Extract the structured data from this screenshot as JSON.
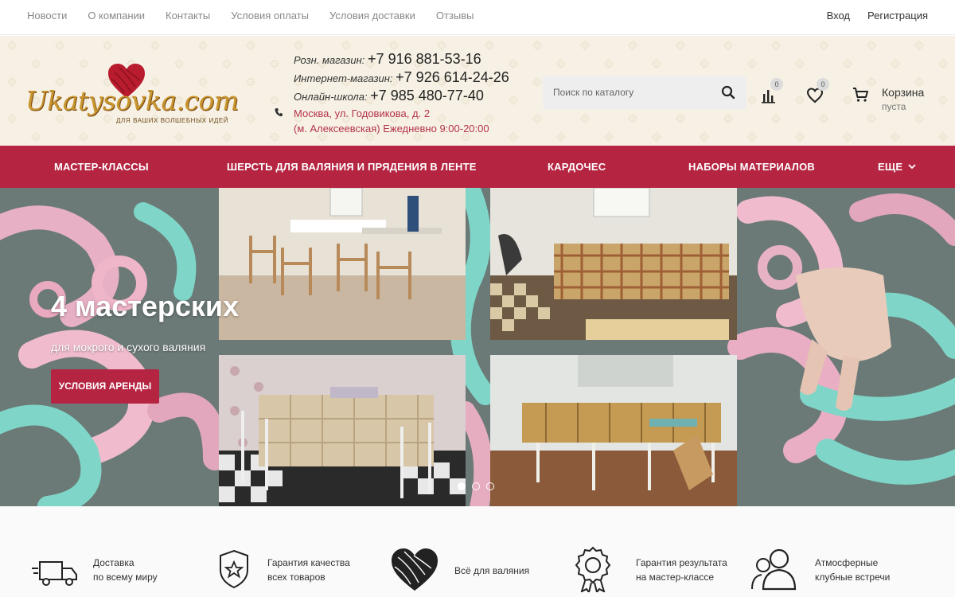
{
  "topnav": {
    "items": [
      "Новости",
      "О компании",
      "Контакты",
      "Условия оплаты",
      "Условия доставки",
      "Отзывы"
    ],
    "login": "Вход",
    "register": "Регистрация"
  },
  "logo": {
    "wordmark": "Ukatysovka.com",
    "tagline": "ДЛЯ ВАШИХ ВОЛШЕБНЫХ ИДЕЙ"
  },
  "contacts": {
    "retail_label": "Розн. магазин:",
    "retail_phone": "+7 916 881-53-16",
    "online_label": "Интернет-магазин:",
    "online_phone": "+7 926 614-24-26",
    "school_label": "Онлайн-школа:",
    "school_phone": "+7 985 480-77-40",
    "address": "Москва, ул. Годовикова, д. 2",
    "hours": "(м. Алексеевская) Ежедневно 9:00-20:00"
  },
  "search": {
    "placeholder": "Поиск по каталогу"
  },
  "counters": {
    "compare": "0",
    "favorites": "0"
  },
  "cart": {
    "title": "Корзина",
    "status": "пуста"
  },
  "mainnav": {
    "items": [
      "МАСТЕР-КЛАССЫ",
      "ШЕРСТЬ ДЛЯ ВАЛЯНИЯ И ПРЯДЕНИЯ В ЛЕНТЕ",
      "КАРДОЧЕС",
      "НАБОРЫ МАТЕРИАЛОВ"
    ],
    "more": "ЕЩЕ"
  },
  "hero": {
    "title": "4 мастерских",
    "subtitle": "для мокрого и сухого валяния",
    "button": "УСЛОВИЯ АРЕНДЫ",
    "slides": 3,
    "active_slide": 1
  },
  "features": [
    {
      "icon": "truck-icon",
      "line1": "Доставка",
      "line2": "по всему миру"
    },
    {
      "icon": "shield-star-icon",
      "line1": "Гарантия качества",
      "line2": "всех товаров"
    },
    {
      "icon": "yarn-heart-icon",
      "line1": "Всё для валяния",
      "line2": ""
    },
    {
      "icon": "medal-icon",
      "line1": "Гарантия результата",
      "line2": "на мастер-классе"
    },
    {
      "icon": "people-icon",
      "line1": "Атмосферные",
      "line2": "клубные встречи"
    }
  ],
  "colors": {
    "brand": "#b52441",
    "header_bg": "#f6f1e4",
    "logo_gold": "#c9952e"
  }
}
